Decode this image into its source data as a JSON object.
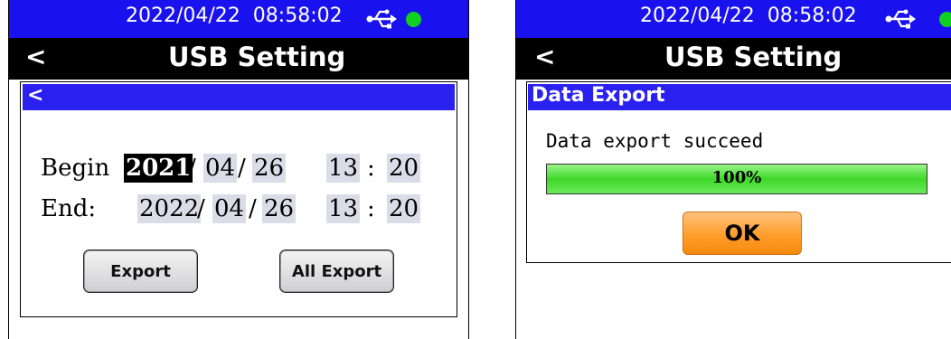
{
  "left": {
    "status": {
      "datetime": "2022/04/22  08:58:02",
      "usb_icon": "usb-icon",
      "connection_color": "#10d020"
    },
    "titlebar": {
      "back": "<",
      "title": "USB Setting"
    },
    "panel": {
      "back": "<"
    },
    "begin": {
      "label": "Begin",
      "year": "2021",
      "month": "04",
      "day": "26",
      "hour": "13",
      "minute": "20"
    },
    "end": {
      "label": "End:",
      "year": "2022",
      "month": "04",
      "day": "26",
      "hour": "13",
      "minute": "20"
    },
    "separators": {
      "date": "/",
      "time": ":"
    },
    "buttons": {
      "export": "Export",
      "all_export": "All Export"
    }
  },
  "right": {
    "status": {
      "datetime": "2022/04/22  08:58:02",
      "usb_icon": "usb-icon",
      "connection_color": "#10d020"
    },
    "titlebar": {
      "back": "<",
      "title": "USB Setting"
    },
    "dialog": {
      "title": "Data Export",
      "message": "Data export succeed",
      "progress": 1.0,
      "progress_label": "100%",
      "ok": "OK"
    }
  },
  "colors": {
    "statusbar": "#1a12ee",
    "panel_header": "#2a20f0",
    "progress": "#3fd82a",
    "ok_button": "#ff9a26"
  }
}
